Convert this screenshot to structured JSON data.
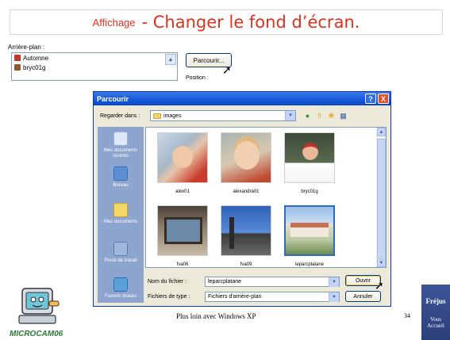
{
  "slide": {
    "title_prefix": "Affichage",
    "title_main": "- Changer le fond d’écran.",
    "footer_text": "Plus loin avec Windows XP",
    "page_number": "34",
    "logo_text": "MICROCAM06",
    "badge_name": "Fréjus",
    "badge_line1": "Vous",
    "badge_line2": "Accueil"
  },
  "background_dialog": {
    "label": "Arrière-plan :",
    "items": [
      {
        "label": "Automne",
        "color": "#c0392b"
      },
      {
        "label": "bryc01g",
        "color": "#8e5a2e"
      }
    ],
    "browse_button": "Parcourir...",
    "position_label": "Position :"
  },
  "dialog": {
    "title": "Parcourir",
    "help_label": "?",
    "close_label": "X",
    "look_in_label": "Regarder dans :",
    "look_in_value": "images",
    "places": [
      {
        "label": "Mes documents récents",
        "color": "#dde7f5"
      },
      {
        "label": "Bureau",
        "color": "#5c8fd6"
      },
      {
        "label": "Mes documents",
        "color": "#f3d86a"
      },
      {
        "label": "Poste de travail",
        "color": "#9fb8de"
      },
      {
        "label": "Favoris réseau",
        "color": "#5aa0d8"
      }
    ],
    "files": [
      {
        "label": "alex01"
      },
      {
        "label": "alexandra01"
      },
      {
        "label": "bryc01g"
      },
      {
        "label": "fva06"
      },
      {
        "label": "fva09"
      },
      {
        "label": "leparcplatane"
      }
    ],
    "filename_label": "Nom du fichier :",
    "filename_value": "leparcplatane",
    "filetype_label": "Fichiers de type :",
    "filetype_value": "Fichiers d'arrière-plan",
    "open_button": "Ouvrir",
    "cancel_button": "Annuler"
  }
}
